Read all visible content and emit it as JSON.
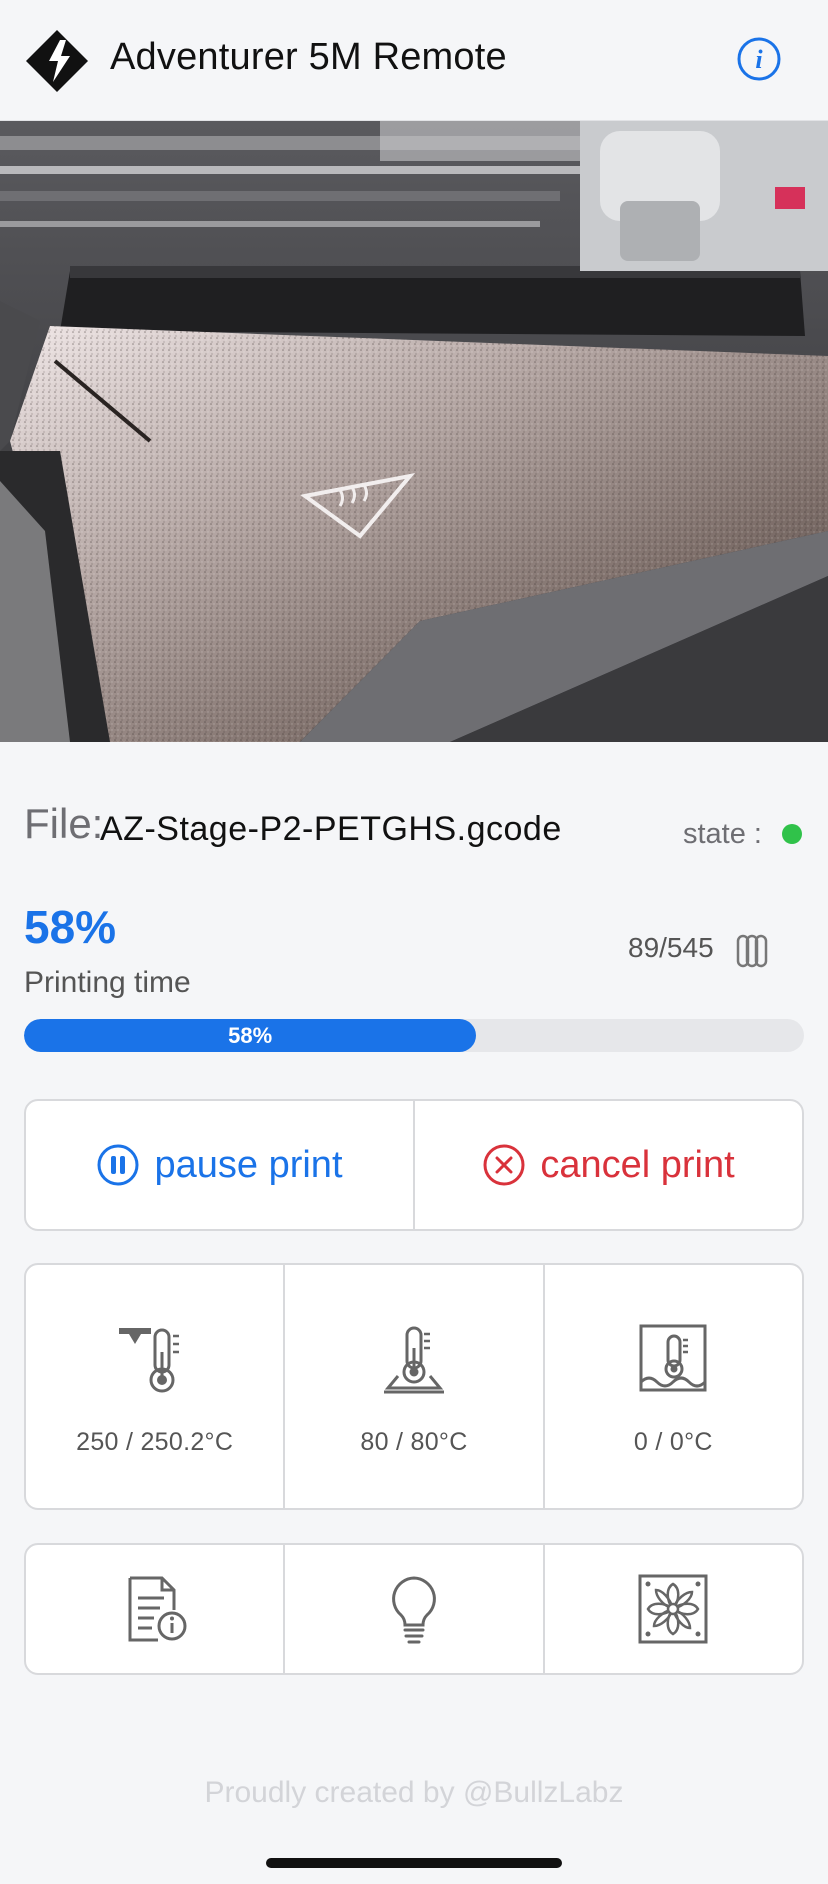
{
  "header": {
    "title": "Adventurer 5M Remote",
    "logo_icon": "flashforge-logo-icon",
    "info_icon": "info-icon"
  },
  "camera": {
    "description_icon": "camera-feed"
  },
  "file": {
    "label": "File:",
    "name": "AZ-Stage-P2-PETGHS.gcode",
    "state_label": "state :",
    "state_color": "#30c24a"
  },
  "progress": {
    "percent_text": "58%",
    "percent_value": 0.58,
    "time_label": "Printing time",
    "bar_text": "58%",
    "layers": "89/545",
    "layers_icon": "layers-icon"
  },
  "actions": {
    "pause_label": "pause print",
    "cancel_label": "cancel print",
    "pause_icon": "pause-circle-icon",
    "cancel_icon": "close-circle-icon"
  },
  "temps": {
    "nozzle": "250 / 250.2°C",
    "bed": "80 / 80°C",
    "chamber": "0 / 0°C"
  },
  "tools": {
    "file_info_icon": "file-info-icon",
    "light_icon": "lightbulb-icon",
    "fan_icon": "fan-icon"
  },
  "footer": {
    "credit": "Proudly created by @BullzLabz"
  },
  "colors": {
    "accent": "#1a73e8",
    "danger": "#d9323b",
    "ok": "#30c24a"
  }
}
